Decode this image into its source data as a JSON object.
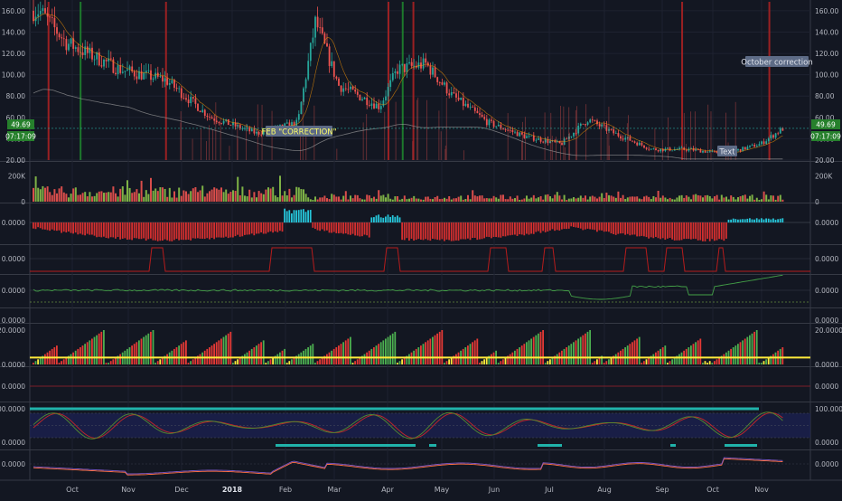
{
  "colors": {
    "background": "#131722",
    "grid": "#1e2230",
    "separator": "#363a45",
    "axis_text": "#b2b5be",
    "bull": "#26a69a",
    "bear": "#ef5350",
    "vline_red": "#b22222",
    "vline_green": "#1f8a2e",
    "price_tag": "#26802c",
    "yellow": "#ffeb3b",
    "cyan": "#26c6da",
    "teal_band": "#20b2aa",
    "osc_fill": "#1c2150"
  },
  "annotations": {
    "feb_correction": "FEB \"CORRECTION\"",
    "october_correction": "October correction",
    "text_box": "Text"
  },
  "price_tags": {
    "last_price": "49.69",
    "countdown": "07:17:09"
  },
  "x_axis": {
    "labels": [
      "Oct",
      "Nov",
      "Dec",
      "2018",
      "Feb",
      "Mar",
      "Apr",
      "May",
      "Jun",
      "Jul",
      "Aug",
      "Sep",
      "Oct",
      "Nov"
    ]
  },
  "panes": {
    "price": {
      "ticks": [
        "160.00",
        "140.00",
        "120.00",
        "100.00",
        "80.00",
        "60.00",
        "40.00",
        "20.00"
      ]
    },
    "volume": {
      "ticks": [
        "200K",
        "0"
      ]
    },
    "osc1": {
      "ticks": [
        "0.0000"
      ]
    },
    "osc2": {
      "ticks": [
        "0.0000"
      ]
    },
    "osc3": {
      "ticks": [
        "0.0000"
      ]
    },
    "osc4": {
      "ticks": [
        "0.0000"
      ]
    },
    "osc5": {
      "ticks": [
        "20.0000",
        "0.0000"
      ]
    },
    "osc6": {
      "ticks": [
        "0.0000"
      ]
    },
    "osc7": {
      "ticks": [
        "100.0000",
        "0.0000"
      ]
    },
    "osc8": {
      "ticks": [
        "0.0000"
      ]
    }
  },
  "chart_data": {
    "type": "candlestick",
    "x_range": [
      "Sep 2017",
      "Nov 2018"
    ],
    "price_range": [
      20,
      165
    ],
    "price_trend": [
      {
        "date": "2017-09-05",
        "value": 160
      },
      {
        "date": "2017-09-20",
        "value": 130
      },
      {
        "date": "2017-10-20",
        "value": 105
      },
      {
        "date": "2017-11-15",
        "value": 95
      },
      {
        "date": "2017-12-10",
        "value": 60
      },
      {
        "date": "2018-01-05",
        "value": 45
      },
      {
        "date": "2018-01-28",
        "value": 55
      },
      {
        "date": "2018-02-07",
        "value": 150
      },
      {
        "date": "2018-02-20",
        "value": 90
      },
      {
        "date": "2018-03-15",
        "value": 70
      },
      {
        "date": "2018-03-25",
        "value": 105
      },
      {
        "date": "2018-04-10",
        "value": 110
      },
      {
        "date": "2018-04-25",
        "value": 80
      },
      {
        "date": "2018-05-15",
        "value": 55
      },
      {
        "date": "2018-06-05",
        "value": 42
      },
      {
        "date": "2018-06-25",
        "value": 35
      },
      {
        "date": "2018-07-10",
        "value": 58
      },
      {
        "date": "2018-07-25",
        "value": 45
      },
      {
        "date": "2018-08-15",
        "value": 30
      },
      {
        "date": "2018-09-05",
        "value": 30
      },
      {
        "date": "2018-09-25",
        "value": 26
      },
      {
        "date": "2018-10-15",
        "value": 35
      },
      {
        "date": "2018-10-28",
        "value": 50
      }
    ],
    "vertical_markers": [
      {
        "date": "2017-09-10",
        "color": "red"
      },
      {
        "date": "2017-09-28",
        "color": "green"
      },
      {
        "date": "2017-11-15",
        "color": "red"
      },
      {
        "date": "2018-03-20",
        "color": "red"
      },
      {
        "date": "2018-03-28",
        "color": "green"
      },
      {
        "date": "2018-04-03",
        "color": "red"
      },
      {
        "date": "2018-09-01",
        "color": "red"
      },
      {
        "date": "2018-10-20",
        "color": "red"
      }
    ],
    "horizontal_levels": [
      {
        "pane": "osc5",
        "value": 4,
        "color": "yellow"
      }
    ]
  }
}
